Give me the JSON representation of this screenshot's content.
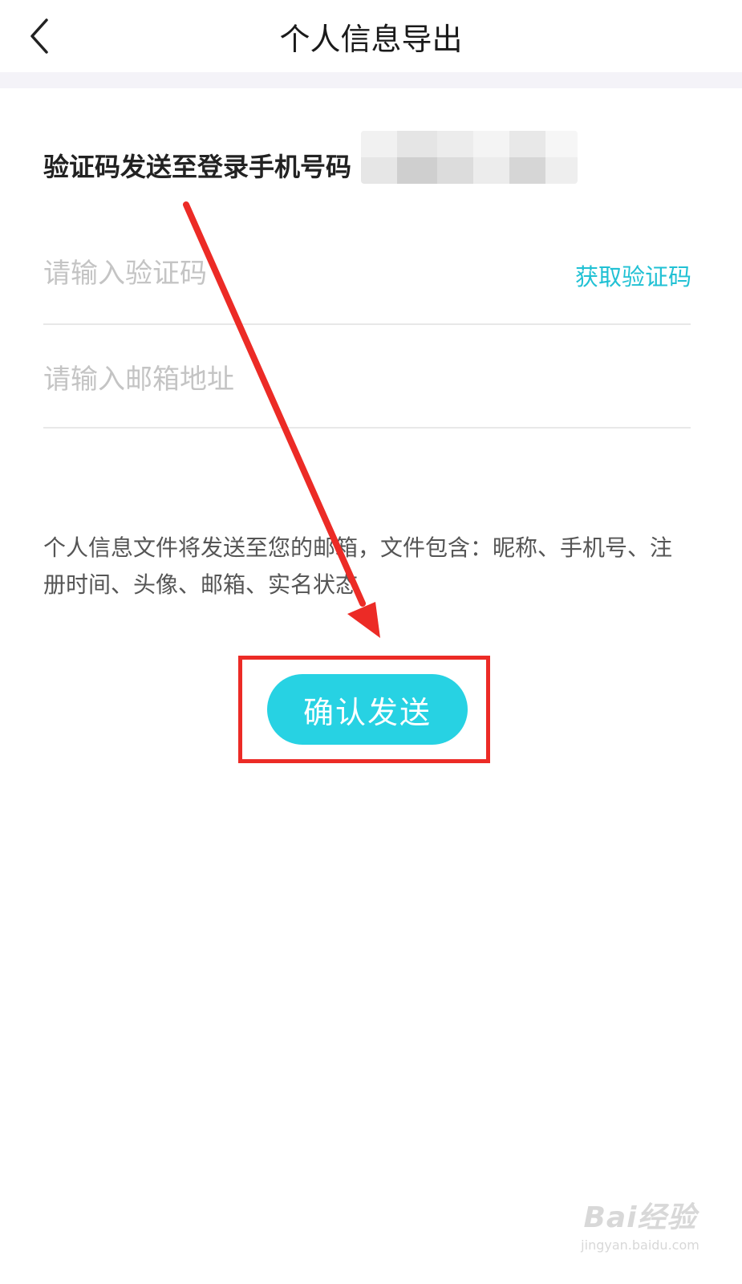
{
  "header": {
    "title": "个人信息导出",
    "back_icon": "chevron-left-icon"
  },
  "verify": {
    "sent_label": "验证码发送至登录手机号码"
  },
  "form": {
    "code_placeholder": "请输入验证码",
    "get_code_label": "获取验证码",
    "email_placeholder": "请输入邮箱地址"
  },
  "notice": {
    "text": "个人信息文件将发送至您的邮箱，文件包含：昵称、手机号、注册时间、头像、邮箱、实名状态"
  },
  "actions": {
    "confirm_label": "确认发送"
  },
  "annotation": {
    "highlight_color": "#ec2b26"
  },
  "watermark": {
    "logo_text": "Bai经验",
    "url": "jingyan.baidu.com"
  },
  "colors": {
    "accent": "#27d2e3",
    "link": "#21c1d4"
  }
}
